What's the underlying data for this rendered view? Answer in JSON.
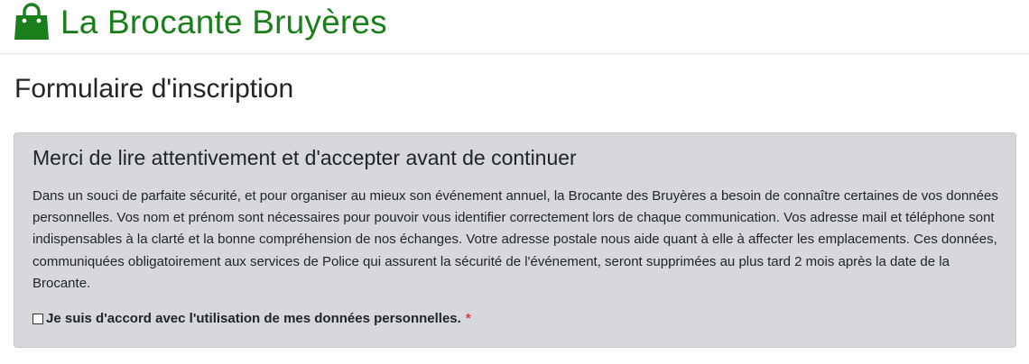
{
  "header": {
    "brand_title": "La Brocante Bruyères",
    "brand_icon": "shopping-bag-icon",
    "brand_color": "#1a7f1a"
  },
  "page": {
    "title": "Formulaire d'inscription"
  },
  "consent": {
    "heading": "Merci de lire attentivement et d'accepter avant de continuer",
    "body": "Dans un souci de parfaite sécurité, et pour organiser au mieux son événement annuel, la Brocante des Bruyères a besoin de connaître certaines de vos données personnelles. Vos nom et prénom sont nécessaires pour pouvoir vous identifier correctement lors de chaque communication. Vos adresse mail et téléphone sont indispensables à la clarté et la bonne compréhension de nos échanges. Votre adresse postale nous aide quant à elle à affecter les emplacements. Ces données, communiquées obligatoirement aux services de Police qui assurent la sécurité de l'événement, seront supprimées au plus tard 2 mois après la date de la Brocante.",
    "checkbox_label": "Je suis d'accord avec l'utilisation de mes données personnelles.",
    "checkbox_checked": false,
    "required_marker": "*",
    "required_color": "#dc3545",
    "card_background": "#d6d8db"
  }
}
